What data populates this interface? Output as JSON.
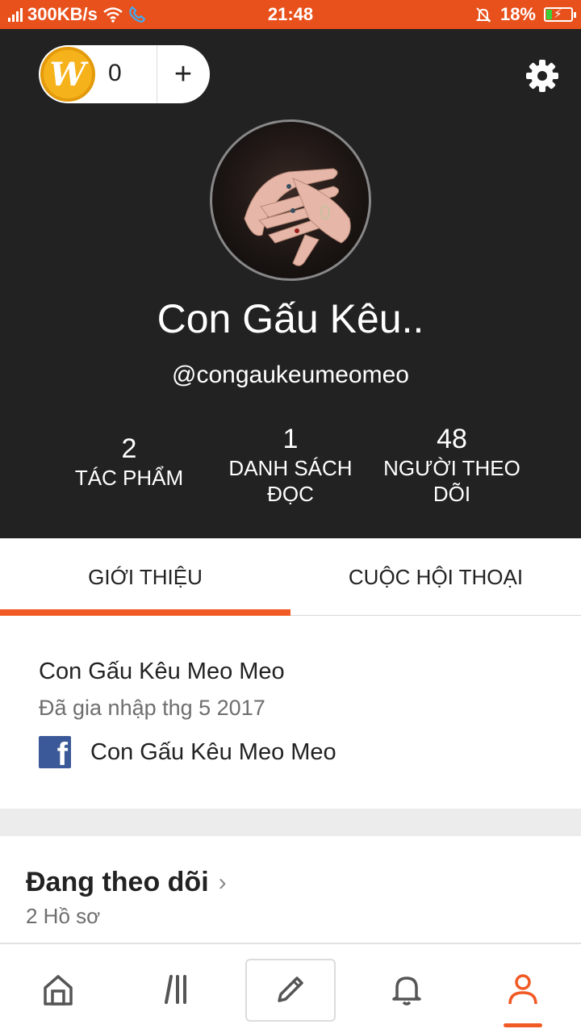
{
  "status_bar": {
    "speed": "300KB/s",
    "time": "21:48",
    "battery": "18%",
    "icons": [
      "signal-icon",
      "wifi-icon",
      "call-icon",
      "mute-icon",
      "battery-icon"
    ]
  },
  "header": {
    "coin_count": "0",
    "coin_logo": "W",
    "add_label": "+",
    "display_name": "Con Gấu Kêu..",
    "username": "@congaukeumeomeo",
    "stats": [
      {
        "value": "2",
        "label": "TÁC PHẨM"
      },
      {
        "value": "1",
        "label": "DANH SÁCH ĐỌC"
      },
      {
        "value": "48",
        "label": "NGƯỜI THEO DÕI"
      }
    ]
  },
  "tabs": [
    {
      "label": "GIỚI THIỆU",
      "active": true
    },
    {
      "label": "CUỘC HỘI THOẠI",
      "active": false
    }
  ],
  "about": {
    "name": "Con Gấu Kêu Meo Meo",
    "joined": "Đã gia nhập thg 5 2017",
    "facebook_name": "Con Gấu Kêu Meo Meo"
  },
  "following": {
    "title": "Đang theo dõi",
    "count": "2 Hồ sơ"
  },
  "bottom_nav": {
    "items": [
      "home-icon",
      "library-icon",
      "write-icon",
      "notifications-icon",
      "profile-icon"
    ],
    "active": "profile-icon"
  },
  "colors": {
    "accent": "#f15a24",
    "status_bar": "#e8501c",
    "header_bg": "#222222",
    "facebook": "#3b5998"
  }
}
